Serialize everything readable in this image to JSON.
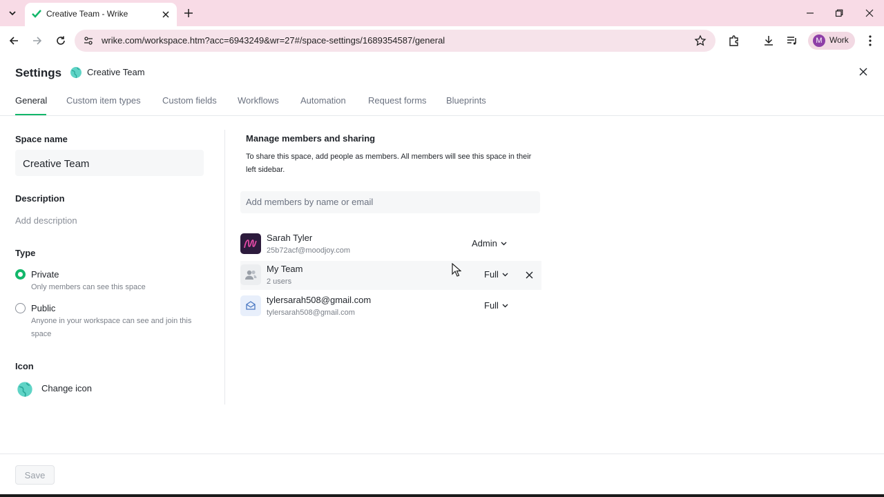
{
  "browser": {
    "tab_title": "Creative Team - Wrike",
    "url": "wrike.com/workspace.htm?acc=6943249&wr=27#/space-settings/1689354587/general",
    "profile_initial": "M",
    "profile_label": "Work"
  },
  "settings": {
    "title": "Settings",
    "space_name": "Creative Team",
    "tabs": [
      {
        "label": "General"
      },
      {
        "label": "Custom item types"
      },
      {
        "label": "Custom fields"
      },
      {
        "label": "Workflows"
      },
      {
        "label": "Automation"
      },
      {
        "label": "Request forms"
      },
      {
        "label": "Blueprints"
      }
    ]
  },
  "general": {
    "space_name_label": "Space name",
    "space_name_value": "Creative Team",
    "description_label": "Description",
    "description_placeholder": "Add description",
    "type_label": "Type",
    "type_options": [
      {
        "label": "Private",
        "help": "Only members can see this space",
        "selected": true
      },
      {
        "label": "Public",
        "help": "Anyone in your workspace can see and join this space",
        "selected": false
      }
    ],
    "icon_label": "Icon",
    "change_icon_label": "Change icon"
  },
  "sharing": {
    "title": "Manage members and sharing",
    "description": "To share this space, add people as members. All members will see this space in their left sidebar.",
    "add_members_placeholder": "Add members by name or email",
    "members": [
      {
        "name": "Sarah Tyler",
        "sub": "25b72acf@moodjoy.com",
        "role": "Admin"
      },
      {
        "name": "My Team",
        "sub": "2 users",
        "role": "Full"
      },
      {
        "name": "tylersarah508@gmail.com",
        "sub": "tylersarah508@gmail.com",
        "role": "Full"
      }
    ]
  },
  "footer": {
    "save_label": "Save"
  },
  "colors": {
    "accent": "#12b76a",
    "chrome_tabbar": "#f8dbe6",
    "omnibox": "#f6e3ea",
    "member_avatar": "#2d1b3d"
  }
}
